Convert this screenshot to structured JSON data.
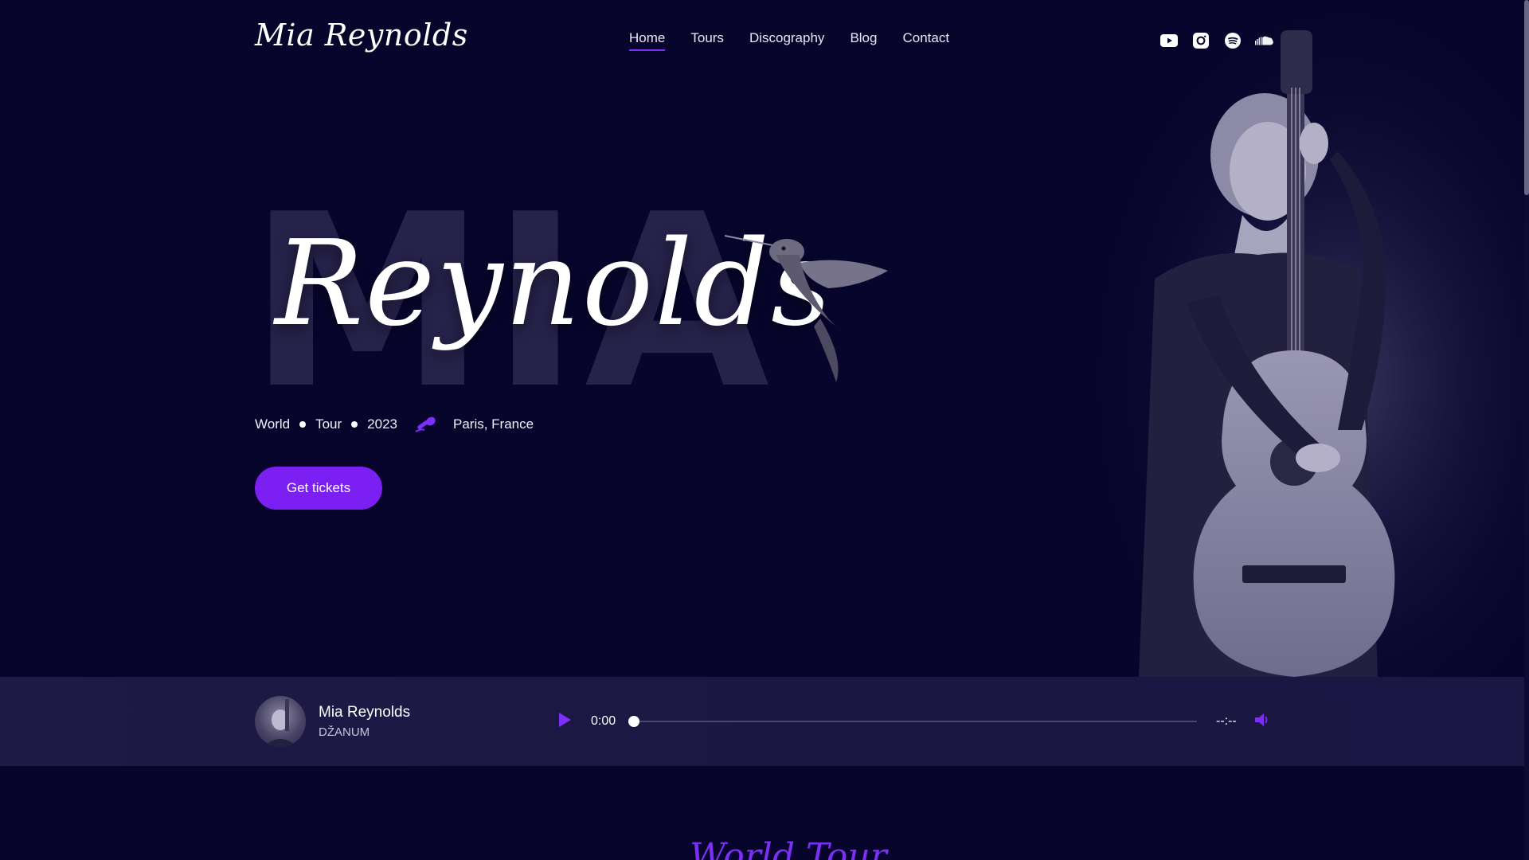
{
  "header": {
    "logo": "Mia Reynolds",
    "nav": [
      "Home",
      "Tours",
      "Discography",
      "Blog",
      "Contact"
    ],
    "active_nav": "Home",
    "socials": [
      "youtube-icon",
      "instagram-icon",
      "spotify-icon",
      "soundcloud-icon"
    ]
  },
  "hero": {
    "bg_text": "MIA",
    "script_text": "Reynolds",
    "meta": {
      "word1": "World",
      "word2": "Tour",
      "year": "2023",
      "icon": "microphone-icon",
      "location": "Paris, France"
    },
    "cta_label": "Get tickets"
  },
  "player": {
    "artist": "Mia Reynolds",
    "title": "DŽANUM",
    "current_time": "0:00",
    "total_time": "--:--",
    "progress": 0
  },
  "next_section": {
    "heading": "World Tour"
  },
  "colors": {
    "background": "#07052c",
    "accent": "#7b1ff2",
    "player_bg": "#1d1a45"
  }
}
